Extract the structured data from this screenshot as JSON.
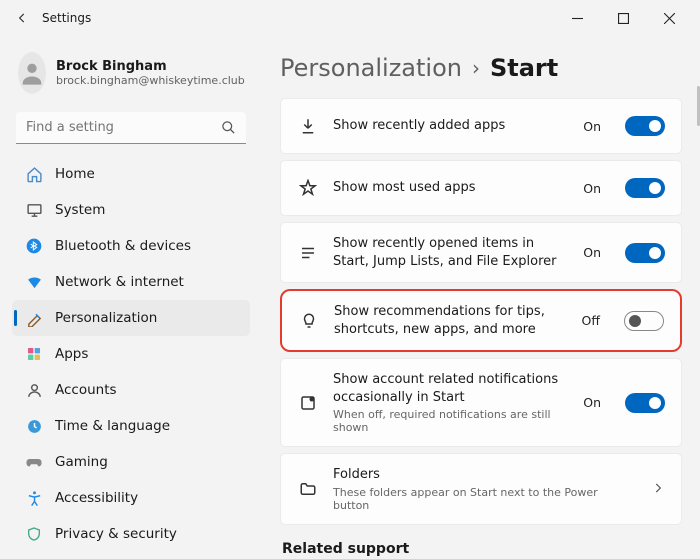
{
  "window": {
    "title": "Settings"
  },
  "user": {
    "name": "Brock Bingham",
    "email": "brock.bingham@whiskeytime.club"
  },
  "search": {
    "placeholder": "Find a setting"
  },
  "nav": [
    {
      "key": "home",
      "label": "Home"
    },
    {
      "key": "system",
      "label": "System"
    },
    {
      "key": "bluetooth",
      "label": "Bluetooth & devices"
    },
    {
      "key": "network",
      "label": "Network & internet"
    },
    {
      "key": "personalization",
      "label": "Personalization",
      "selected": true
    },
    {
      "key": "apps",
      "label": "Apps"
    },
    {
      "key": "accounts",
      "label": "Accounts"
    },
    {
      "key": "time",
      "label": "Time & language"
    },
    {
      "key": "gaming",
      "label": "Gaming"
    },
    {
      "key": "accessibility",
      "label": "Accessibility"
    },
    {
      "key": "privacy",
      "label": "Privacy & security"
    }
  ],
  "breadcrumb": {
    "parent": "Personalization",
    "current": "Start"
  },
  "settings": [
    {
      "key": "recent-apps",
      "title": "Show recently added apps",
      "state": "On",
      "toggle": "on"
    },
    {
      "key": "most-used",
      "title": "Show most used apps",
      "state": "On",
      "toggle": "on"
    },
    {
      "key": "recent-items",
      "title": "Show recently opened items in Start, Jump Lists, and File Explorer",
      "state": "On",
      "toggle": "on"
    },
    {
      "key": "recommendations",
      "title": "Show recommendations for tips, shortcuts, new apps, and more",
      "state": "Off",
      "toggle": "off",
      "highlight": true
    },
    {
      "key": "account-notifs",
      "title": "Show account related notifications occasionally in Start",
      "subtitle": "When off, required notifications are still shown",
      "state": "On",
      "toggle": "on"
    },
    {
      "key": "folders",
      "title": "Folders",
      "subtitle": "These folders appear on Start next to the Power button",
      "nav": true
    }
  ],
  "relatedHeader": "Related support"
}
